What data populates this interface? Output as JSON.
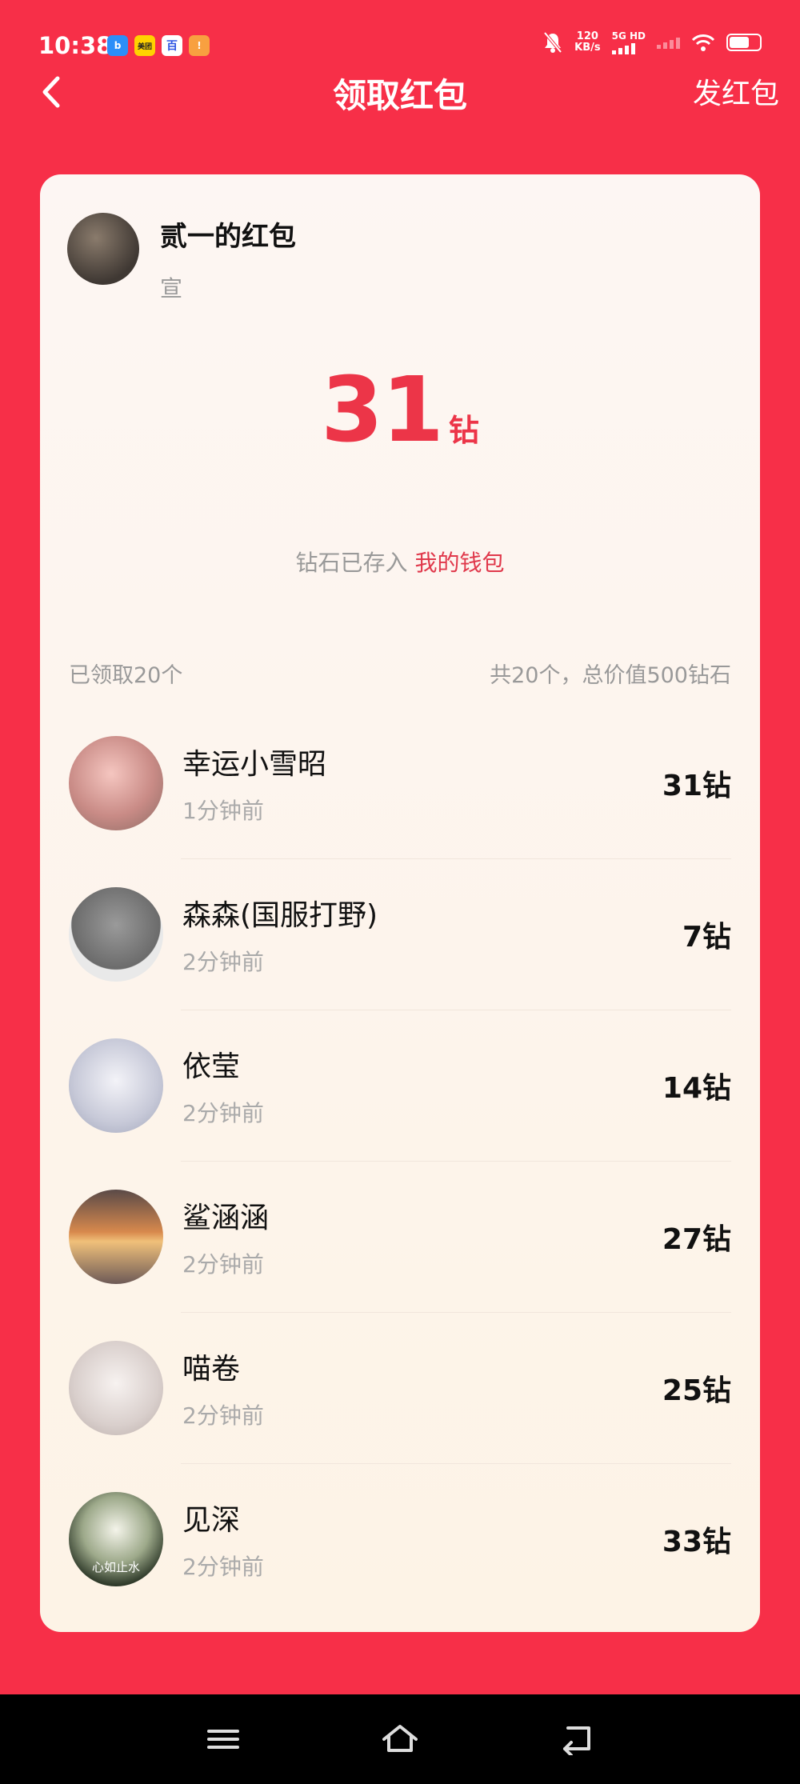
{
  "status_bar": {
    "time": "10:38",
    "app_icons": [
      "b",
      "美团",
      "百",
      "!"
    ],
    "net_speed_top": "120",
    "net_speed_bottom": "KB/s",
    "network_type": "5G HD"
  },
  "header": {
    "title": "领取红包",
    "action_label": "发红包"
  },
  "card": {
    "sender_title": "贰一的红包",
    "sender_subtitle": "宣",
    "amount_value": "31",
    "amount_unit": "钻",
    "wallet_note_prefix": "钻石已存入",
    "wallet_link": "我的钱包",
    "received_count": "已领取20个",
    "total_summary": "共20个，总价值500钻石",
    "recipients": [
      {
        "name": "幸运小雪昭",
        "time": "1分钟前",
        "amount": "31钻"
      },
      {
        "name": "森森(国服打野)",
        "time": "2分钟前",
        "amount": "7钻"
      },
      {
        "name": "依莹",
        "time": "2分钟前",
        "amount": "14钻"
      },
      {
        "name": "鲨涵涵",
        "time": "2分钟前",
        "amount": "27钻"
      },
      {
        "name": "喵卷",
        "time": "2分钟前",
        "amount": "25钻"
      },
      {
        "name": "见深",
        "time": "2分钟前",
        "amount": "33钻",
        "avatar_text": "心如止水"
      }
    ]
  },
  "colors": {
    "background": "#f72f48",
    "accent": "#ec3548",
    "card_top": "#fdf6f3",
    "card_bottom": "#fdf3e6"
  }
}
